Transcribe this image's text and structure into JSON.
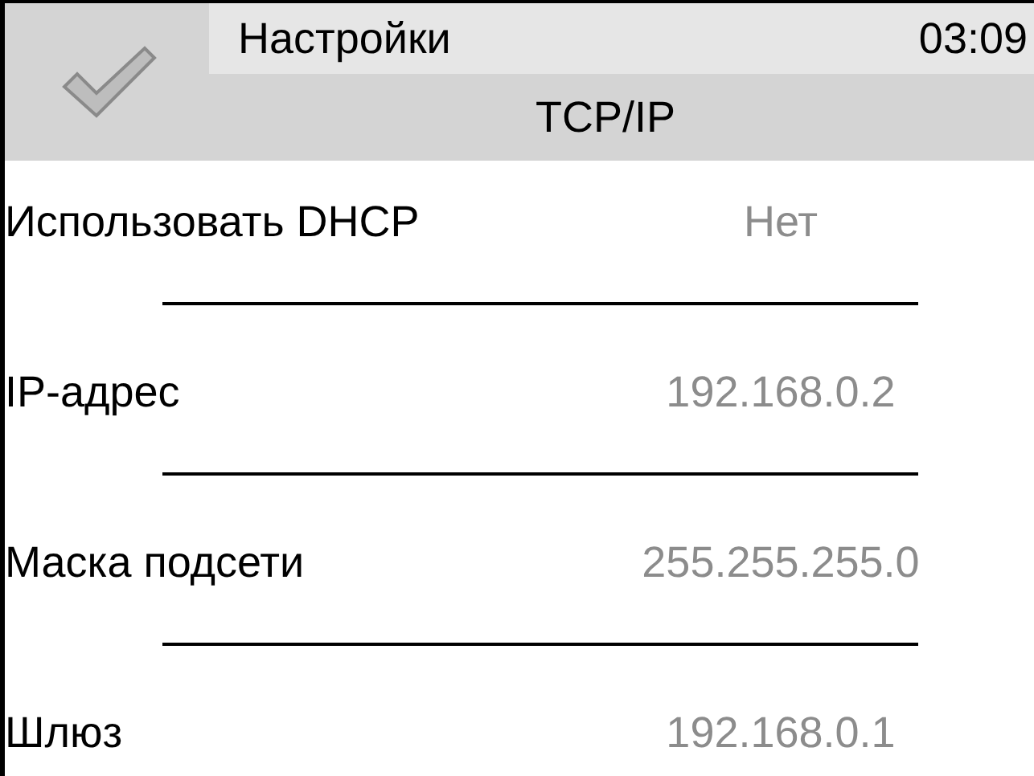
{
  "header": {
    "title": "Настройки",
    "time": "03:09",
    "subtitle": "TCP/IP"
  },
  "rows": [
    {
      "label": "Использовать DHCP",
      "value": "Нет"
    },
    {
      "label": "IP-адрес",
      "value": "192.168.0.2"
    },
    {
      "label": "Маска подсети",
      "value": "255.255.255.0"
    },
    {
      "label": "Шлюз",
      "value": "192.168.0.1"
    }
  ]
}
